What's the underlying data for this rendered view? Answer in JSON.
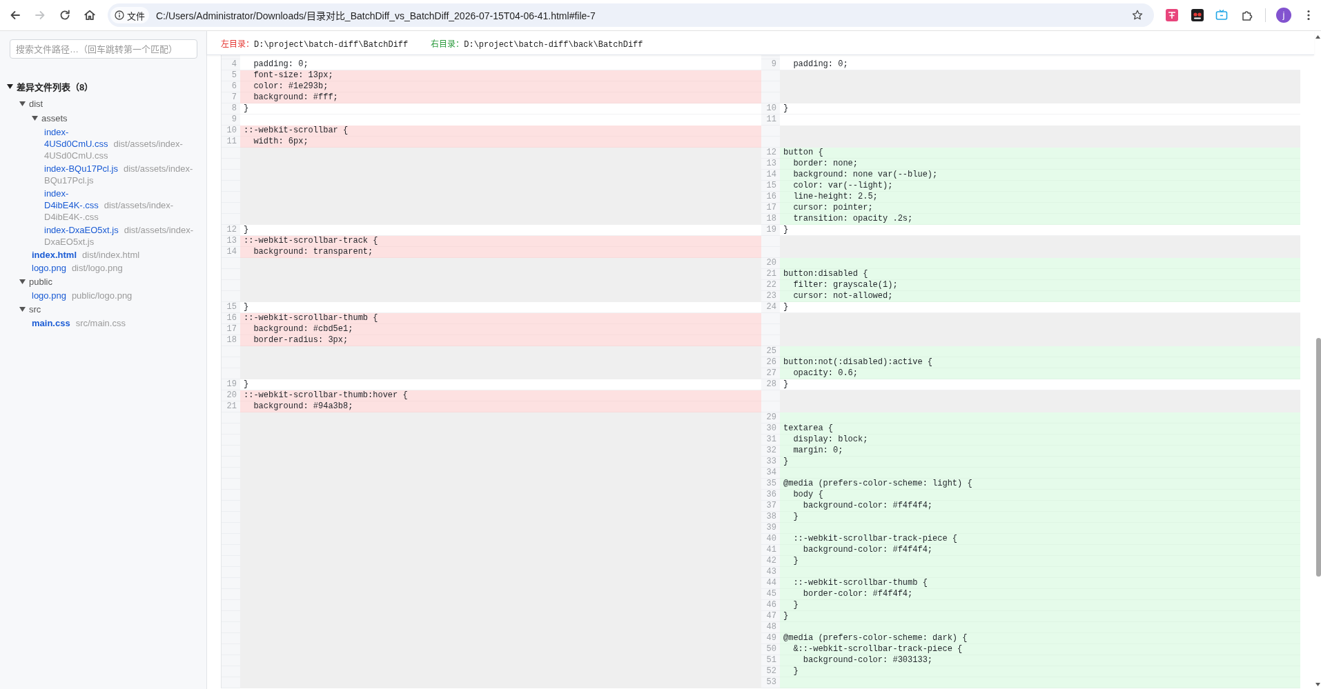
{
  "browser": {
    "nav_buttons": [
      {
        "kind": "back",
        "disabled": false
      },
      {
        "kind": "forward",
        "disabled": true
      },
      {
        "kind": "reload",
        "disabled": false
      },
      {
        "kind": "home",
        "disabled": false
      }
    ],
    "address_bar": {
      "chip": "文件",
      "url": "C:/Users/Administrator/Downloads/目录对比_BatchDiff_vs_BatchDiff_2026-07-15T04-06-41.html#file-7"
    },
    "profile_initial": "j"
  },
  "sidebar": {
    "search": {
      "placeholder": "搜索文件路径…（回车跳转第一个匹配）"
    },
    "tree": {
      "title": "差异文件列表（8）",
      "expanded": true,
      "children": [
        {
          "kind": "folder",
          "name": "dist",
          "expanded": true,
          "children": [
            {
              "kind": "folder",
              "name": "assets",
              "expanded": true,
              "children": [
                {
                  "kind": "file",
                  "name": "index-4USd0CmU.css",
                  "path": "dist/assets/index-4USd0CmU.css",
                  "selected": false
                },
                {
                  "kind": "file",
                  "name": "index-BQu17Pcl.js",
                  "path": "dist/assets/index-BQu17Pcl.js",
                  "selected": false
                },
                {
                  "kind": "file",
                  "name": "index-D4ibE4K-.css",
                  "path": "dist/assets/index-D4ibE4K-.css",
                  "selected": false
                },
                {
                  "kind": "file",
                  "name": "index-DxaEO5xt.js",
                  "path": "dist/assets/index-DxaEO5xt.js",
                  "selected": false
                }
              ]
            },
            {
              "kind": "file",
              "name": "index.html",
              "path": "dist/index.html",
              "selected": true
            },
            {
              "kind": "file",
              "name": "logo.png",
              "path": "dist/logo.png",
              "selected": false
            }
          ]
        },
        {
          "kind": "folder",
          "name": "public",
          "expanded": true,
          "children": [
            {
              "kind": "file",
              "name": "logo.png",
              "path": "public/logo.png",
              "selected": false
            }
          ]
        },
        {
          "kind": "folder",
          "name": "src",
          "expanded": true,
          "children": [
            {
              "kind": "file",
              "name": "main.css",
              "path": "src/main.css",
              "selected": true
            }
          ]
        }
      ]
    }
  },
  "diff": {
    "left_dir": {
      "label": "左目录：",
      "path": "D:\\project\\batch-diff\\BatchDiff"
    },
    "right_dir": {
      "label": "右目录：",
      "path": "D:\\project\\batch-diff\\back\\BatchDiff"
    },
    "rows": [
      {
        "left": {
          "kind": "context",
          "number": "4",
          "text": "  padding: 0;"
        },
        "right": {
          "kind": "context",
          "number": "9",
          "text": "  padding: 0;"
        }
      },
      {
        "left": {
          "kind": "removed",
          "number": "5",
          "text": "  font-size: 13px;"
        },
        "right": {
          "kind": "filler"
        }
      },
      {
        "left": {
          "kind": "removed",
          "number": "6",
          "text": "  color: #1e293b;"
        },
        "right": {
          "kind": "filler"
        }
      },
      {
        "left": {
          "kind": "removed",
          "number": "7",
          "text": "  background: #fff;"
        },
        "right": {
          "kind": "filler"
        }
      },
      {
        "left": {
          "kind": "context",
          "number": "8",
          "text": "}"
        },
        "right": {
          "kind": "context",
          "number": "10",
          "text": "}"
        }
      },
      {
        "left": {
          "kind": "context",
          "number": "9"
        },
        "right": {
          "kind": "context",
          "number": "11"
        }
      },
      {
        "left": {
          "kind": "removed",
          "number": "10",
          "text": "::-webkit-scrollbar {"
        },
        "right": {
          "kind": "filler"
        }
      },
      {
        "left": {
          "kind": "removed",
          "number": "11",
          "text": "  width: 6px;"
        },
        "right": {
          "kind": "filler"
        }
      },
      {
        "left": {
          "kind": "filler"
        },
        "right": {
          "kind": "added",
          "number": "12",
          "text": "button {"
        }
      },
      {
        "left": {
          "kind": "filler"
        },
        "right": {
          "kind": "added",
          "number": "13",
          "text": "  border: none;"
        }
      },
      {
        "left": {
          "kind": "filler"
        },
        "right": {
          "kind": "added",
          "number": "14",
          "text": "  background: none var(--blue);"
        }
      },
      {
        "left": {
          "kind": "filler"
        },
        "right": {
          "kind": "added",
          "number": "15",
          "text": "  color: var(--light);"
        }
      },
      {
        "left": {
          "kind": "filler"
        },
        "right": {
          "kind": "added",
          "number": "16",
          "text": "  line-height: 2.5;"
        }
      },
      {
        "left": {
          "kind": "filler"
        },
        "right": {
          "kind": "added",
          "number": "17",
          "text": "  cursor: pointer;"
        }
      },
      {
        "left": {
          "kind": "filler"
        },
        "right": {
          "kind": "added",
          "number": "18",
          "text": "  transition: opacity .2s;"
        }
      },
      {
        "left": {
          "kind": "context",
          "number": "12",
          "text": "}"
        },
        "right": {
          "kind": "context",
          "number": "19",
          "text": "}"
        }
      },
      {
        "left": {
          "kind": "removed",
          "number": "13",
          "text": "::-webkit-scrollbar-track {"
        },
        "right": {
          "kind": "filler"
        }
      },
      {
        "left": {
          "kind": "removed",
          "number": "14",
          "text": "  background: transparent;"
        },
        "right": {
          "kind": "filler"
        }
      },
      {
        "left": {
          "kind": "filler"
        },
        "right": {
          "kind": "added",
          "number": "20"
        }
      },
      {
        "left": {
          "kind": "filler"
        },
        "right": {
          "kind": "added",
          "number": "21",
          "text": "button:disabled {"
        }
      },
      {
        "left": {
          "kind": "filler"
        },
        "right": {
          "kind": "added",
          "number": "22",
          "text": "  filter: grayscale(1);"
        }
      },
      {
        "left": {
          "kind": "filler"
        },
        "right": {
          "kind": "added",
          "number": "23",
          "text": "  cursor: not-allowed;"
        }
      },
      {
        "left": {
          "kind": "context",
          "number": "15",
          "text": "}"
        },
        "right": {
          "kind": "context",
          "number": "24",
          "text": "}"
        }
      },
      {
        "left": {
          "kind": "removed",
          "number": "16",
          "text": "::-webkit-scrollbar-thumb {"
        },
        "right": {
          "kind": "filler"
        }
      },
      {
        "left": {
          "kind": "removed",
          "number": "17",
          "text": "  background: #cbd5e1;"
        },
        "right": {
          "kind": "filler"
        }
      },
      {
        "left": {
          "kind": "removed",
          "number": "18",
          "text": "  border-radius: 3px;"
        },
        "right": {
          "kind": "filler"
        }
      },
      {
        "left": {
          "kind": "filler"
        },
        "right": {
          "kind": "added",
          "number": "25"
        }
      },
      {
        "left": {
          "kind": "filler"
        },
        "right": {
          "kind": "added",
          "number": "26",
          "text": "button:not(:disabled):active {"
        }
      },
      {
        "left": {
          "kind": "filler"
        },
        "right": {
          "kind": "added",
          "number": "27",
          "text": "  opacity: 0.6;"
        }
      },
      {
        "left": {
          "kind": "context",
          "number": "19",
          "text": "}"
        },
        "right": {
          "kind": "context",
          "number": "28",
          "text": "}"
        }
      },
      {
        "left": {
          "kind": "removed",
          "number": "20",
          "text": "::-webkit-scrollbar-thumb:hover {"
        },
        "right": {
          "kind": "filler"
        }
      },
      {
        "left": {
          "kind": "removed",
          "number": "21",
          "text": "  background: #94a3b8;"
        },
        "right": {
          "kind": "filler"
        }
      },
      {
        "left": {
          "kind": "filler"
        },
        "right": {
          "kind": "added",
          "number": "29"
        }
      },
      {
        "left": {
          "kind": "filler"
        },
        "right": {
          "kind": "added",
          "number": "30",
          "text": "textarea {"
        }
      },
      {
        "left": {
          "kind": "filler"
        },
        "right": {
          "kind": "added",
          "number": "31",
          "text": "  display: block;"
        }
      },
      {
        "left": {
          "kind": "filler"
        },
        "right": {
          "kind": "added",
          "number": "32",
          "text": "  margin: 0;"
        }
      },
      {
        "left": {
          "kind": "filler"
        },
        "right": {
          "kind": "added",
          "number": "33",
          "text": "}"
        }
      },
      {
        "left": {
          "kind": "filler"
        },
        "right": {
          "kind": "added",
          "number": "34"
        }
      },
      {
        "left": {
          "kind": "filler"
        },
        "right": {
          "kind": "added",
          "number": "35",
          "text": "@media (prefers-color-scheme: light) {"
        }
      },
      {
        "left": {
          "kind": "filler"
        },
        "right": {
          "kind": "added",
          "number": "36",
          "text": "  body {"
        }
      },
      {
        "left": {
          "kind": "filler"
        },
        "right": {
          "kind": "added",
          "number": "37",
          "text": "    background-color: #f4f4f4;"
        }
      },
      {
        "left": {
          "kind": "filler"
        },
        "right": {
          "kind": "added",
          "number": "38",
          "text": "  }"
        }
      },
      {
        "left": {
          "kind": "filler"
        },
        "right": {
          "kind": "added",
          "number": "39"
        }
      },
      {
        "left": {
          "kind": "filler"
        },
        "right": {
          "kind": "added",
          "number": "40",
          "text": "  ::-webkit-scrollbar-track-piece {"
        }
      },
      {
        "left": {
          "kind": "filler"
        },
        "right": {
          "kind": "added",
          "number": "41",
          "text": "    background-color: #f4f4f4;"
        }
      },
      {
        "left": {
          "kind": "filler"
        },
        "right": {
          "kind": "added",
          "number": "42",
          "text": "  }"
        }
      },
      {
        "left": {
          "kind": "filler"
        },
        "right": {
          "kind": "added",
          "number": "43"
        }
      },
      {
        "left": {
          "kind": "filler"
        },
        "right": {
          "kind": "added",
          "number": "44",
          "text": "  ::-webkit-scrollbar-thumb {"
        }
      },
      {
        "left": {
          "kind": "filler"
        },
        "right": {
          "kind": "added",
          "number": "45",
          "text": "    border-color: #f4f4f4;"
        }
      },
      {
        "left": {
          "kind": "filler"
        },
        "right": {
          "kind": "added",
          "number": "46",
          "text": "  }"
        }
      },
      {
        "left": {
          "kind": "filler"
        },
        "right": {
          "kind": "added",
          "number": "47",
          "text": "}"
        }
      },
      {
        "left": {
          "kind": "filler"
        },
        "right": {
          "kind": "added",
          "number": "48"
        }
      },
      {
        "left": {
          "kind": "filler"
        },
        "right": {
          "kind": "added",
          "number": "49",
          "text": "@media (prefers-color-scheme: dark) {"
        }
      },
      {
        "left": {
          "kind": "filler"
        },
        "right": {
          "kind": "added",
          "number": "50",
          "text": "  &::-webkit-scrollbar-track-piece {"
        }
      },
      {
        "left": {
          "kind": "filler"
        },
        "right": {
          "kind": "added",
          "number": "51",
          "text": "    background-color: #303133;"
        }
      },
      {
        "left": {
          "kind": "filler"
        },
        "right": {
          "kind": "added",
          "number": "52",
          "text": "  }"
        }
      },
      {
        "left": {
          "kind": "filler"
        },
        "right": {
          "kind": "added",
          "number": "53"
        }
      }
    ]
  }
}
